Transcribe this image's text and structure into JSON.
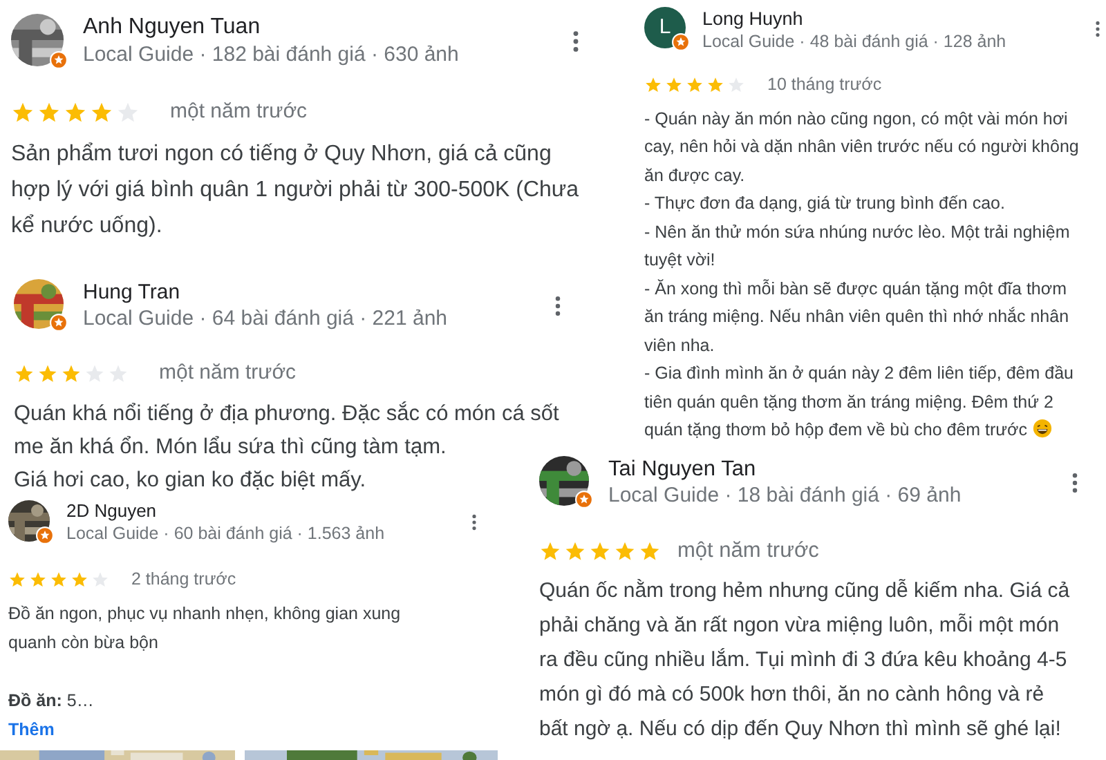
{
  "reviews": [
    {
      "avatar": {
        "kind": "picture"
      },
      "name": "Anh Nguyen Tuan",
      "meta": "Local Guide · 182 bài đánh giá · 630 ảnh",
      "local_guide": true,
      "stars": 4,
      "time": "một năm trước",
      "paragraphs": [
        [
          "Sản phẩm tươi ngon có tiếng ở Quy Nhơn, giá cả cũng",
          "hợp lý với giá bình quân 1 người phải từ 300-500K (Chưa",
          "kể nước uống)."
        ]
      ]
    },
    {
      "avatar": {
        "kind": "picture"
      },
      "name": "Hung Tran",
      "meta": "Local Guide · 64 bài đánh giá · 221 ảnh",
      "local_guide": true,
      "stars": 3,
      "time": "một năm trước",
      "paragraphs": [
        [
          "Quán khá nổi tiếng ở địa phương. Đặc sắc có món cá sốt",
          "me ăn khá ổn. Món lẩu sứa thì cũng tàm tạm.",
          "Giá hơi cao, ko gian ko đặc biệt mấy."
        ]
      ]
    },
    {
      "avatar": {
        "kind": "picture"
      },
      "name": "2D Nguyen",
      "meta": "Local Guide · 60 bài đánh giá · 1.563 ảnh",
      "local_guide": true,
      "stars": 4,
      "time": "2 tháng trước",
      "paragraphs": [
        [
          "Đồ ăn ngon, phục vụ nhanh nhẹn, không gian  xung",
          "quanh còn bừa bộn"
        ]
      ],
      "detail": "**Đồ ăn:** 5…",
      "more_link": "Thêm",
      "photos": [
        {
          "kind": "picture"
        },
        {
          "kind": "picture"
        }
      ]
    },
    {
      "avatar": {
        "kind": "letter",
        "letter": "L"
      },
      "name": "Long Huynh",
      "meta": "Local Guide · 48 bài đánh giá · 128 ảnh",
      "local_guide": true,
      "stars": 4,
      "time": "10 tháng trước",
      "paragraphs": [
        [
          "- Quán này ăn món nào cũng ngon, có một vài món hơi",
          "cay, nên hỏi và dặn nhân viên trước nếu có người không",
          "ăn được cay."
        ],
        [
          "- Thực đơn đa dạng, giá từ trung bình đến cao."
        ],
        [
          "- Nên ăn thử món sứa nhúng nước lèo. Một trải nghiệm",
          "tuyệt vời!"
        ],
        [
          "- Ăn xong thì mỗi bàn sẽ được quán tặng một đĩa thơm",
          "ăn tráng miệng. Nếu nhân viên quên thì nhớ nhắc nhân",
          "viên nha."
        ],
        [
          "- Gia đình mình ăn ở quán này 2 đêm liên tiếp, đêm đầu",
          "tiên quán quên tặng thơm ăn tráng miệng. Đêm thứ 2",
          "quán tặng thơm bỏ hộp đem về bù cho đêm trước"
        ]
      ],
      "trailing_emoji": true
    },
    {
      "avatar": {
        "kind": "picture"
      },
      "name": "Tai Nguyen Tan",
      "meta": "Local Guide · 18 bài đánh giá · 69 ảnh",
      "local_guide": true,
      "stars": 5,
      "time": "một năm trước",
      "paragraphs": [
        [
          "Quán ốc nằm trong hẻm nhưng cũng dễ kiếm nha. Giá cả",
          "phải chăng và ăn rất ngon vừa miệng luôn, mỗi một món",
          "ra đều cũng nhiều lắm. Tụi mình đi 3 đứa kêu khoảng 4-5",
          "món gì đó mà có 500k hơn thôi, ăn no cành hông và rẻ",
          "bất ngờ ạ. Nếu có dịp đến Quy Nhơn thì mình sẽ ghé lại!"
        ]
      ]
    }
  ]
}
